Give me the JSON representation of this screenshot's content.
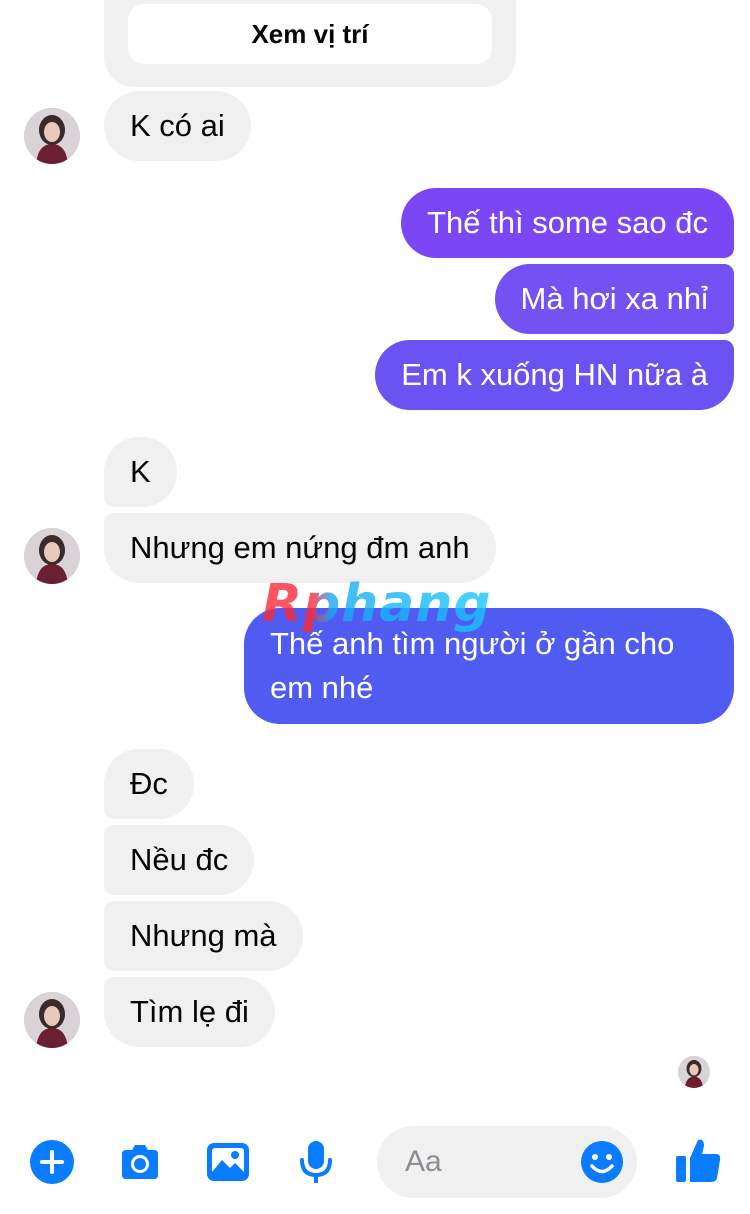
{
  "location_card": {
    "button_label": "Xem vị trí"
  },
  "messages": [
    {
      "text": "K có ai"
    },
    {
      "text": "Thế thì some sao đc"
    },
    {
      "text": "Mà hơi xa nhỉ"
    },
    {
      "text": "Em k xuống HN nữa à"
    },
    {
      "text": "K"
    },
    {
      "text": "Nhưng em nứng đm anh"
    },
    {
      "text_line1": "Thế anh tìm người ở gần cho",
      "text_line2": "em nhé"
    },
    {
      "text": "Đc"
    },
    {
      "text": "Nều đc"
    },
    {
      "text": "Nhưng mà"
    },
    {
      "text": "Tìm lẹ đi"
    }
  ],
  "watermark": {
    "text": "Rphang"
  },
  "composer": {
    "placeholder": "Aa"
  },
  "colors": {
    "incoming_bubble": "#f0f0f0",
    "outgoing_purple": "#7a47f3",
    "outgoing_blue": "#4f5bf0",
    "accent": "#0a7cff"
  },
  "icons": [
    "plus-icon",
    "camera-icon",
    "image-icon",
    "microphone-icon",
    "emoji-icon",
    "thumbs-up-icon"
  ]
}
